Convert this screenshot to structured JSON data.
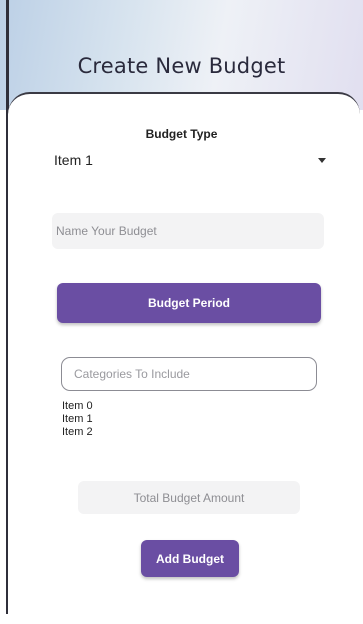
{
  "header": {
    "title": "Create New Budget"
  },
  "form": {
    "budget_type_label": "Budget Type",
    "budget_type_value": "Item 1",
    "name_placeholder": "Name Your Budget",
    "budget_period_label": "Budget Period",
    "categories_placeholder": "Categories To Include",
    "category_items": [
      "Item 0",
      "Item 1",
      "Item 2"
    ],
    "total_amount_placeholder": "Total Budget Amount",
    "add_button_label": "Add Budget"
  },
  "colors": {
    "accent": "#6a4ea3",
    "field_bg": "#f3f3f4"
  },
  "icons": {
    "dropdown": "caret-down-icon"
  }
}
